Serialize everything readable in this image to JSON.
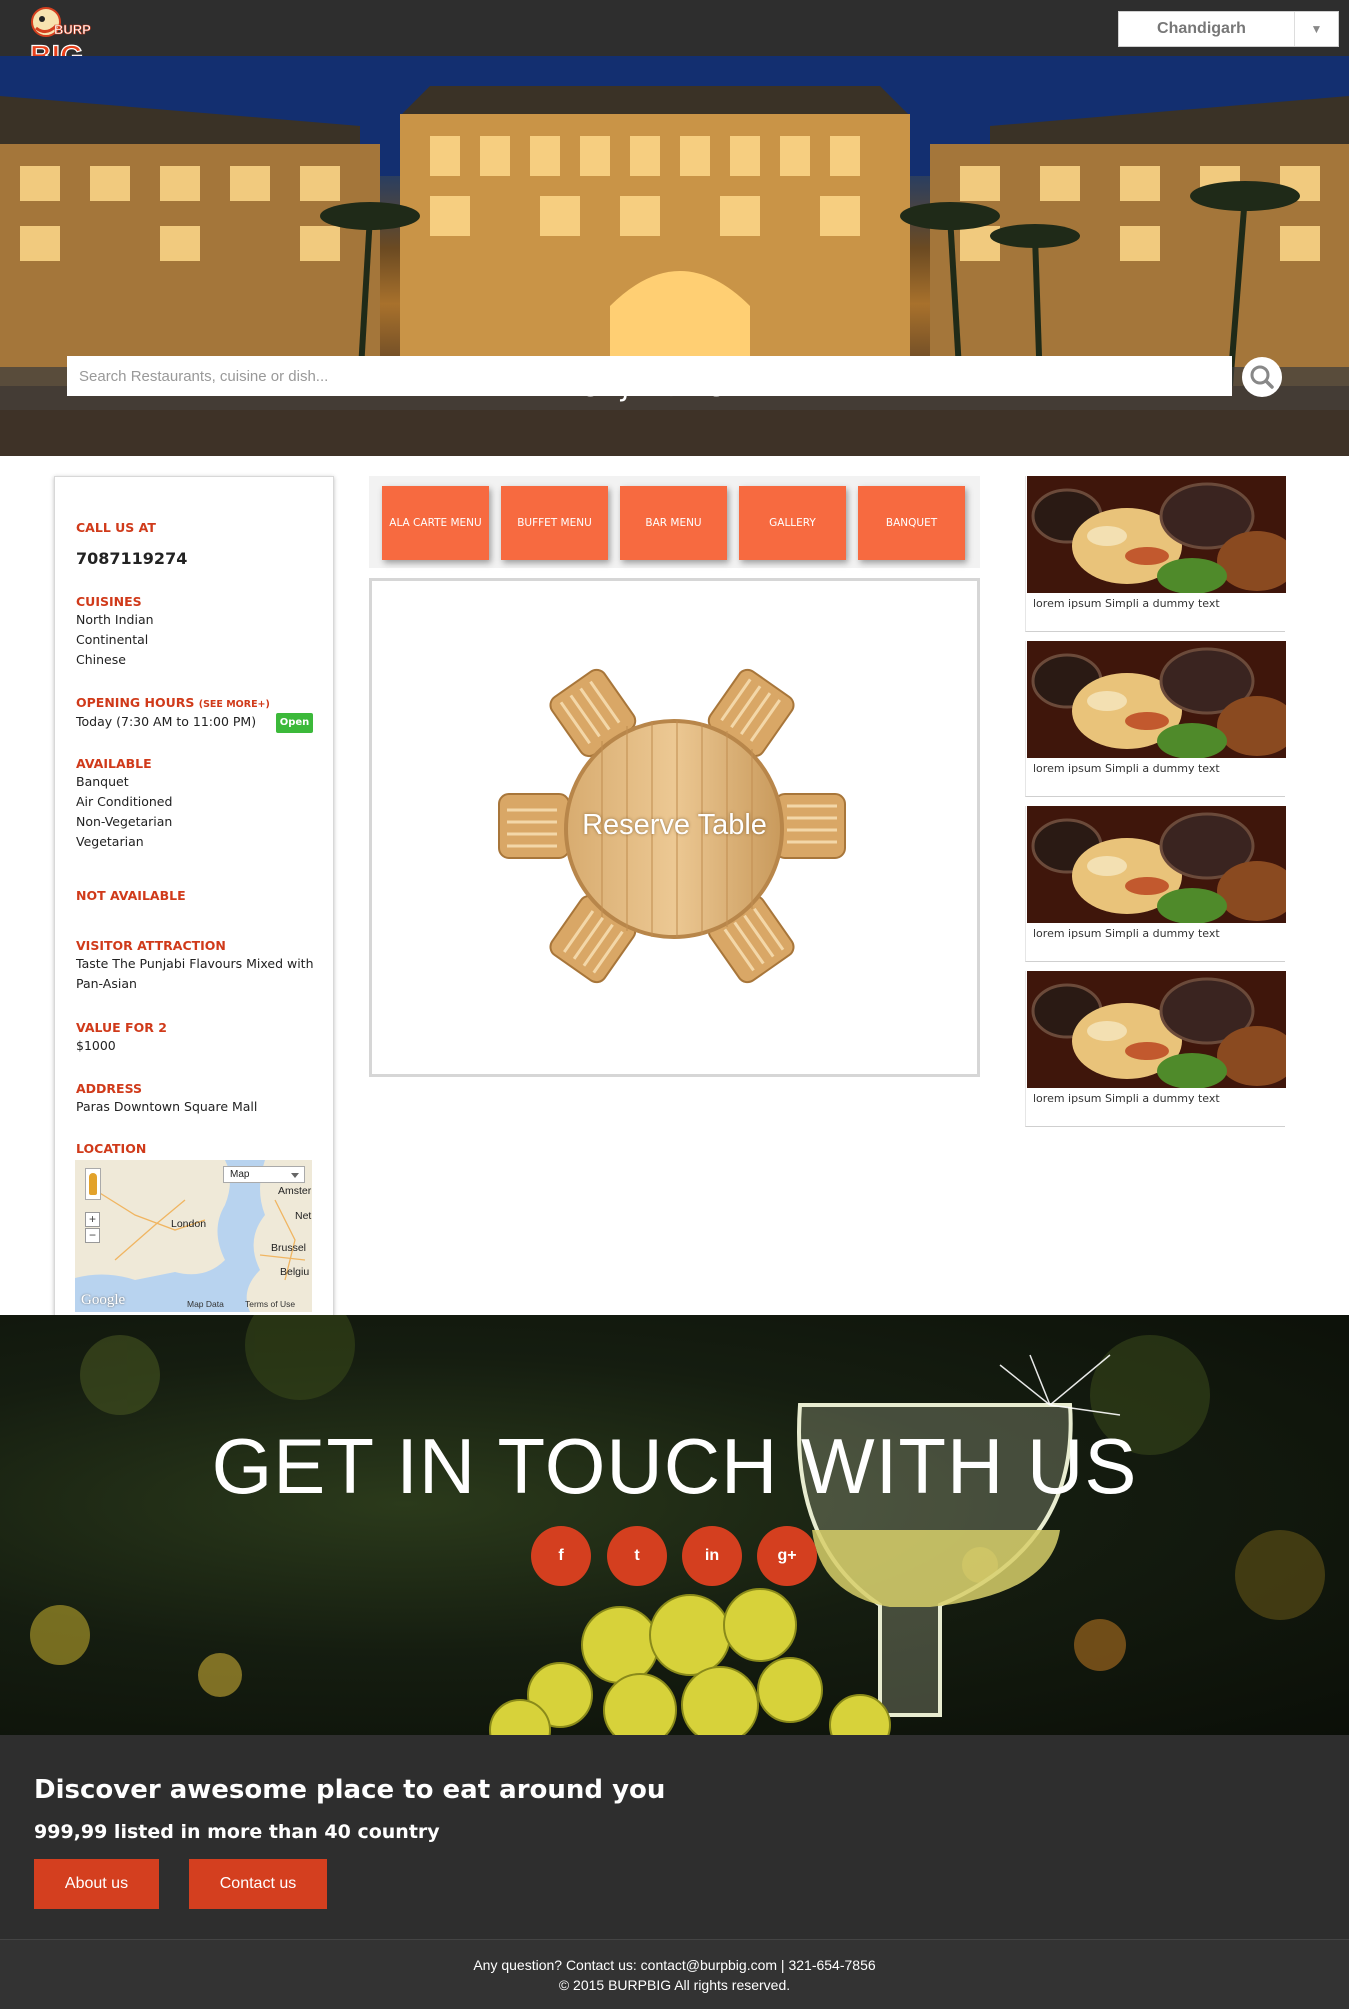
{
  "header": {
    "logo_text_top": "BURP",
    "logo_text_bottom": "BIG",
    "city": "Chandigarh"
  },
  "hero": {
    "title": "PUNJABI NORAH",
    "search_placeholder": "Search Restaurants, cuisine or dish..."
  },
  "info": {
    "call_label": "CALL US AT",
    "phone": "7087119274",
    "cuisines_label": "CUISINES",
    "cuisines": [
      "North Indian",
      "Continental",
      "Chinese"
    ],
    "hours_label": "OPENING HOURS",
    "see_more": "(SEE MORE+)",
    "hours": "Today (7:30 AM to 11:00 PM)",
    "open_badge": "Open",
    "available_label": "AVAILABLE",
    "available": [
      "Banquet",
      "Air Conditioned",
      "Non-Vegetarian",
      "Vegetarian"
    ],
    "not_available_label": "NOT AVAILABLE",
    "attraction_label": "VISITOR ATTRACTION",
    "attraction_line1": "Taste The Punjabi Flavours Mixed with",
    "attraction_line2": "Pan-Asian",
    "value_label": "VALUE FOR 2",
    "value": "$1000",
    "address_label": "ADDRESS",
    "address": "Paras Downtown Square Mall",
    "location_label": "LOCATION",
    "map": {
      "type": "Map",
      "zoom_in": "+",
      "zoom_out": "−",
      "cities": [
        "London",
        "Amster",
        "Net",
        "Brussel",
        "Belgiu"
      ],
      "google": "Google",
      "map_data": "Map Data",
      "terms": "Terms of Use"
    }
  },
  "menu_tabs": [
    "ALA CARTE MENU",
    "BUFFET MENU",
    "BAR MENU",
    "GALLERY",
    "BANQUET"
  ],
  "reserve_label": "Reserve Table",
  "promos": [
    {
      "caption": "lorem ipsum Simpli a dummy text"
    },
    {
      "caption": "lorem ipsum Simpli a dummy text"
    },
    {
      "caption": "lorem ipsum Simpli a dummy text"
    },
    {
      "caption": "lorem ipsum Simpli a dummy text"
    }
  ],
  "touch": {
    "title": "GET IN TOUCH WITH US",
    "social": [
      {
        "icon": "facebook-icon",
        "glyph": "f"
      },
      {
        "icon": "twitter-icon",
        "glyph": "t"
      },
      {
        "icon": "linkedin-icon",
        "glyph": "in"
      },
      {
        "icon": "google-plus-icon",
        "glyph": "g+"
      }
    ]
  },
  "discover": {
    "title": "Discover awesome place to eat around you",
    "subtitle": "999,99 listed in more than 40 country",
    "about_label": "About us",
    "contact_label": "Contact us"
  },
  "footer": {
    "contact_line": "Any question? Contact us: contact@burpbig.com | 321-654-7856",
    "copyright": "© 2015 BURPBIG All rights reserved."
  },
  "colors": {
    "accent": "#d43f1f",
    "menu_button": "#f76a40",
    "dark_bar": "#2e2e2e",
    "open_badge": "#3cb93a"
  }
}
